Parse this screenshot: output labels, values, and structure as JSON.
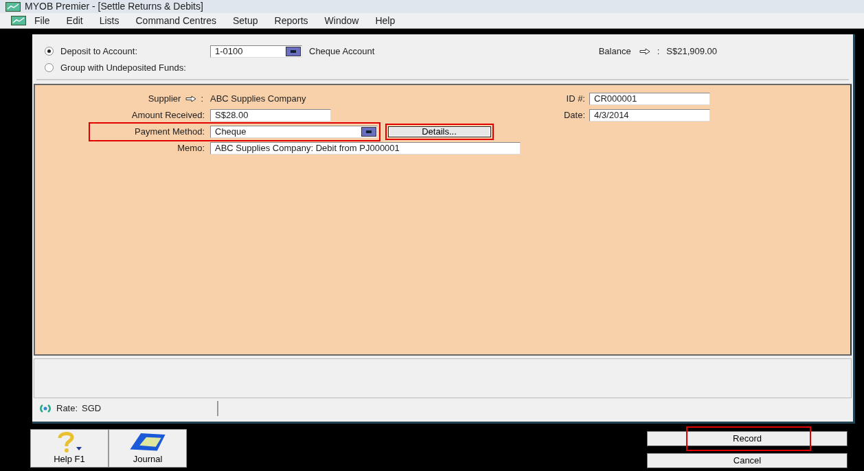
{
  "window": {
    "title": "MYOB Premier - [Settle Returns & Debits]"
  },
  "menu": [
    "File",
    "Edit",
    "Lists",
    "Command Centres",
    "Setup",
    "Reports",
    "Window",
    "Help"
  ],
  "deposit": {
    "options": [
      {
        "label": "Deposit to Account:",
        "selected": true
      },
      {
        "label": "Group with Undeposited Funds:",
        "selected": false
      }
    ],
    "account": "1-0100",
    "account_name": "Cheque Account",
    "balance_label": "Balance",
    "balance_sep": ":",
    "balance": "S$21,909.00"
  },
  "form": {
    "supplier_label": "Supplier",
    "supplier_sep": ":",
    "supplier": "ABC Supplies Company",
    "fields": [
      {
        "label": "Amount Received:",
        "value": "S$28.00",
        "kind": "text",
        "highlighted": false
      },
      {
        "label": "Payment Method:",
        "value": "Cheque",
        "kind": "select",
        "highlighted": true,
        "button": "Details...",
        "button_highlighted": true
      },
      {
        "label": "Memo:",
        "value": "ABC Supplies Company:  Debit from PJ000001",
        "kind": "wide",
        "highlighted": false
      }
    ],
    "right_fields": [
      {
        "label": "ID #:",
        "value": "CR000001"
      },
      {
        "label": "Date:",
        "value": "4/3/2014"
      }
    ]
  },
  "status": {
    "rate_label": "Rate:",
    "rate": "SGD"
  },
  "toolbar": [
    {
      "label": "Help F1",
      "kind": "help"
    },
    {
      "label": "Journal",
      "kind": "journal"
    }
  ],
  "actions": [
    {
      "label": "Record",
      "highlighted": true
    },
    {
      "label": "Cancel",
      "highlighted": false
    }
  ]
}
